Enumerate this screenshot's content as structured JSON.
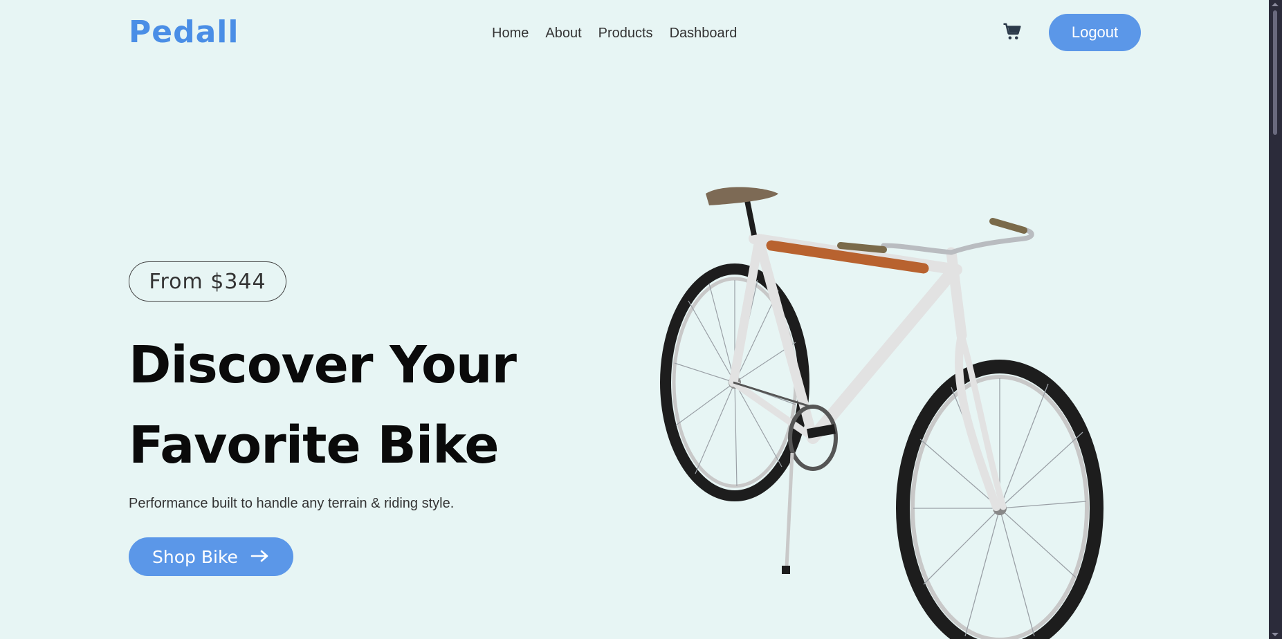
{
  "header": {
    "logo": "Pedall",
    "nav": [
      "Home",
      "About",
      "Products",
      "Dashboard"
    ],
    "cart_icon": "cart-icon",
    "logout_label": "Logout"
  },
  "hero": {
    "price_badge": "From $344",
    "title_line1": "Discover Your",
    "title_line2": "Favorite Bike",
    "subtitle": "Performance built to handle any terrain & riding style.",
    "cta_label": "Shop Bike",
    "cta_icon": "arrow-right-icon"
  },
  "colors": {
    "background": "#e7f5f4",
    "accent": "#5b97e8",
    "logo": "#4a8ee6"
  }
}
